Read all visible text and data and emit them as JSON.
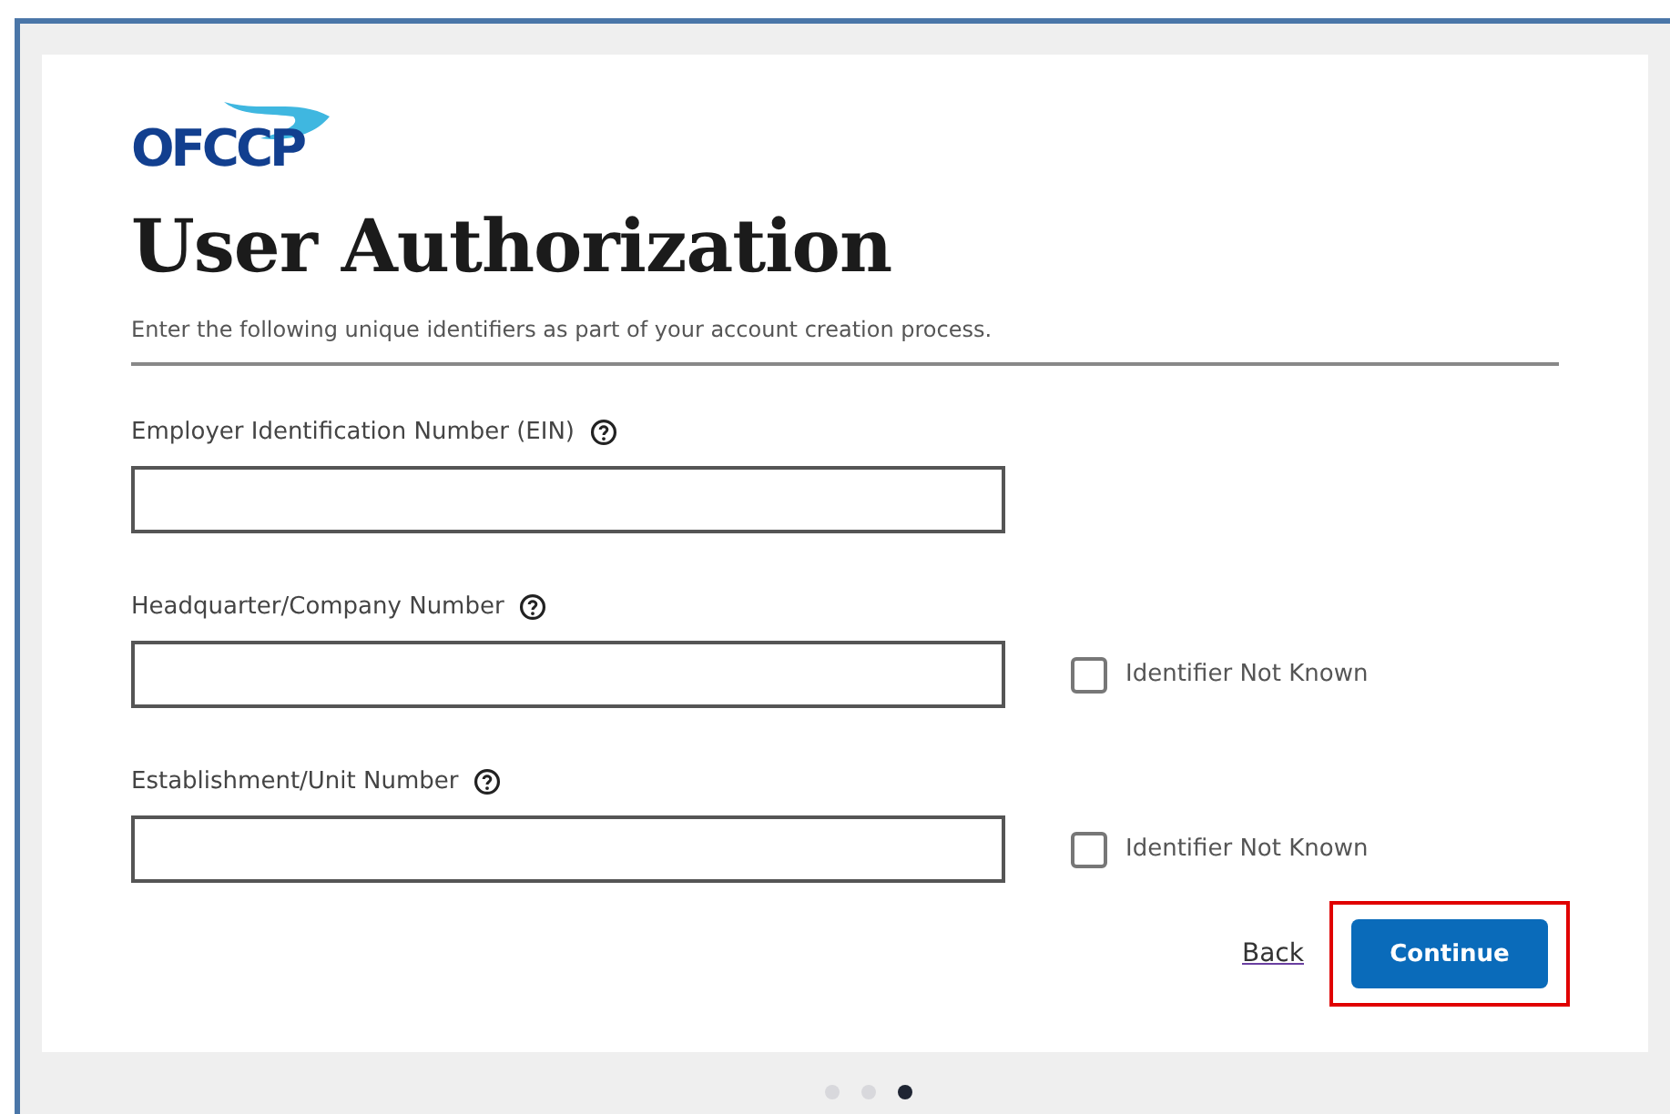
{
  "logo": {
    "text": "OFCCP"
  },
  "title": "User Authorization",
  "intro": "Enter the following unique identifiers as part of your account creation process.",
  "fields": [
    {
      "kind": "plain",
      "label": "Employer Identification Number (EIN)"
    },
    {
      "kind": "optional",
      "label": "Headquarter/Company Number",
      "checkbox_label": "Identifier Not Known",
      "checked": false
    },
    {
      "kind": "optional",
      "label": "Establishment/Unit Number",
      "checkbox_label": "Identifier Not Known",
      "checked": false
    }
  ],
  "back_link": "Back",
  "continue_button": {
    "label": "Continue",
    "highlighted": true
  },
  "steps": [
    {
      "selected": false
    },
    {
      "selected": false
    },
    {
      "selected": true
    }
  ]
}
